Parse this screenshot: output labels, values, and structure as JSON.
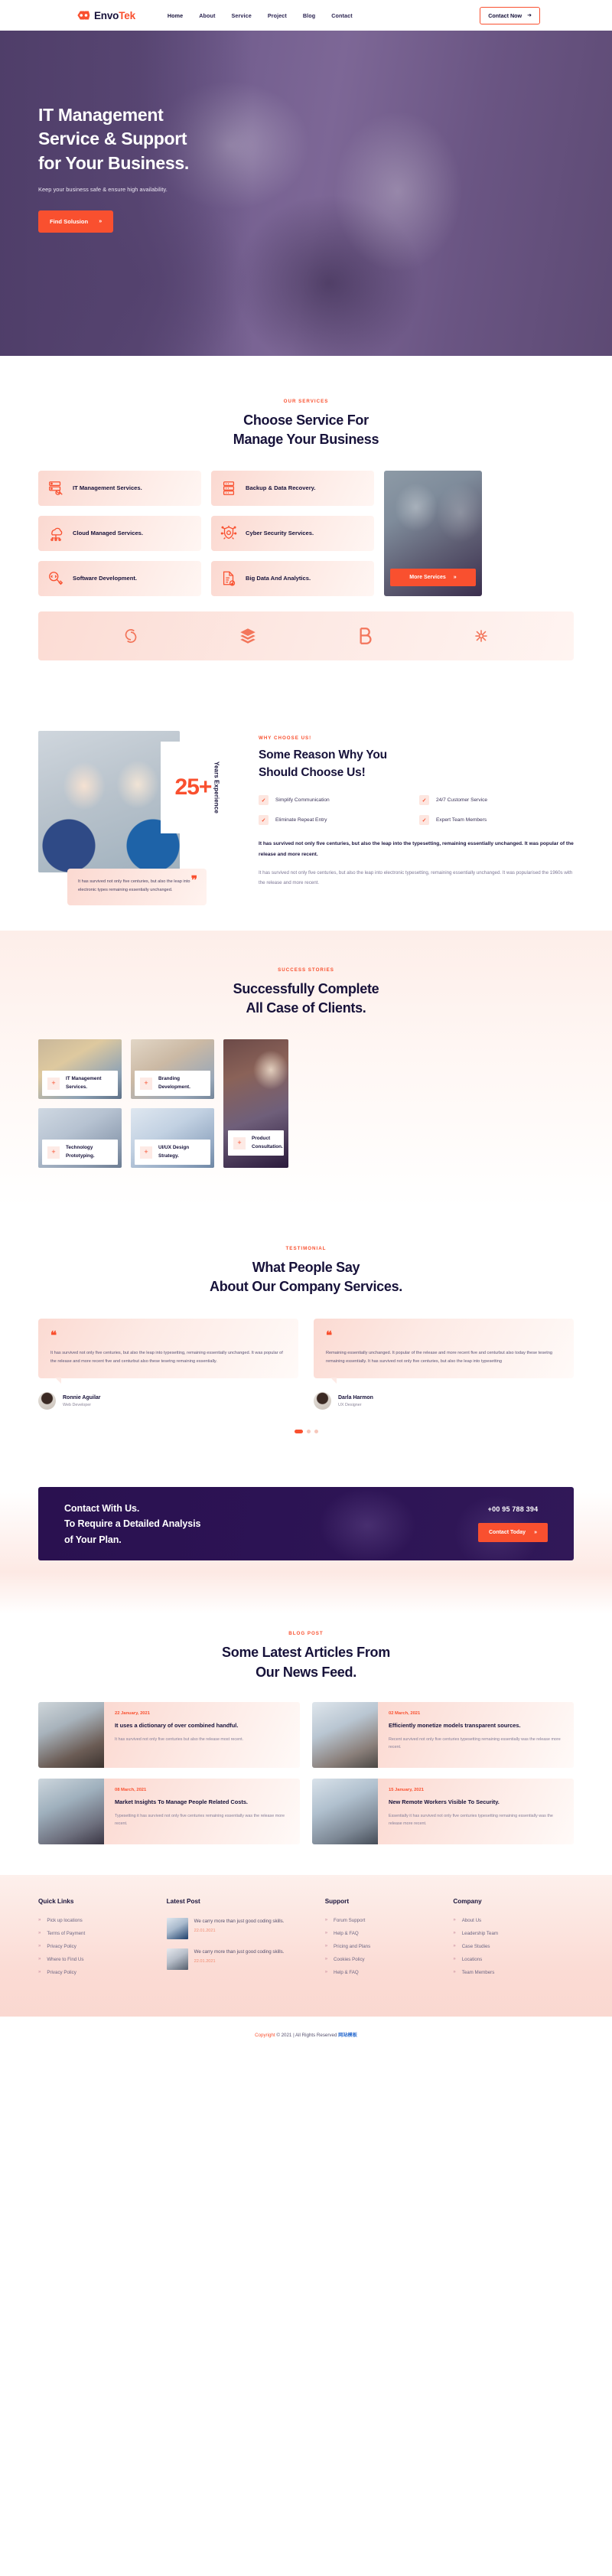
{
  "header": {
    "brand_primary": "Envo",
    "brand_accent": "Tek",
    "nav": [
      {
        "label": "Home",
        "active": true
      },
      {
        "label": "About",
        "active": false
      },
      {
        "label": "Service",
        "active": false
      },
      {
        "label": "Project",
        "active": false
      },
      {
        "label": "Blog",
        "active": false
      },
      {
        "label": "Contact",
        "active": false
      }
    ],
    "cta_label": "Contact Now",
    "cta_arrow": "➜"
  },
  "hero": {
    "title_line1": "IT Management",
    "title_line2": "Service & Support",
    "title_line3": "for Your Business.",
    "subtitle": "Keep your business safe & ensure high availability.",
    "button_label": "Find Solusion",
    "button_arrow": "»"
  },
  "services": {
    "eyebrow": "OUR SERVICES",
    "title_line1": "Choose Service For",
    "title_line2": "Manage Your Business",
    "left_items": [
      {
        "label": "IT Management Services.",
        "icon": "server-click-icon"
      },
      {
        "label": "Cloud Managed Services.",
        "icon": "cloud-network-icon"
      },
      {
        "label": "Software Development.",
        "icon": "code-badge-icon"
      }
    ],
    "right_items": [
      {
        "label": "Backup & Data Recovery.",
        "icon": "server-rack-icon"
      },
      {
        "label": "Cyber Security Services.",
        "icon": "shield-chip-icon"
      },
      {
        "label": "Big Data And Analytics.",
        "icon": "document-check-icon"
      }
    ],
    "more_button": "More Services",
    "more_arrow": "»"
  },
  "partners": [
    {
      "name": "spiral-logo"
    },
    {
      "name": "layers-logo"
    },
    {
      "name": "b-letter-logo"
    },
    {
      "name": "molecule-logo"
    }
  ],
  "why": {
    "eyebrow": "WHY CHOOSE US!",
    "title_line1": "Some Reason Why You",
    "title_line2": "Should Choose Us!",
    "badge_number": "25+",
    "badge_label": "Years Experience",
    "quote": "It has survived not only five centuries, but also the leap into electronic types remaining essentially unchanged.",
    "features": [
      "Simplify Communication",
      "24/7 Customer Service",
      "Eliminate Repeat Entry",
      "Expert Team Members"
    ],
    "lead": "It has survived not only five centuries, but also the leap into the typesetting, remaining essentially unchanged. It was popular of the release and more recent.",
    "body": "It has survived not only five centuries, but also the leap into electronic typesetting, remaining essentially unchanged. It was popularised the 1960s with the release and more recent."
  },
  "success": {
    "eyebrow": "SUCCESS STORIES",
    "title_line1": "Successfully Complete",
    "title_line2": "All Case of Clients.",
    "cases_col1": [
      "IT Management Services.",
      "Technology Prototyping."
    ],
    "cases_col2": [
      "Branding Development.",
      "UI/UX Design Strategy."
    ],
    "case_tall": "Product Consultation."
  },
  "testimonials": {
    "eyebrow": "TESTIMONIAL",
    "title_line1": "What People Say",
    "title_line2": "About Our Company Services.",
    "quote_mark": "❝",
    "items": [
      {
        "text": "It has survived not only five centuries, but also the leap into typesetting, remaining essentially unchanged. It was popular of the release and more recent five and centurbut also these tesetng remaining essentially.",
        "name": "Ronnie Aguilar",
        "role": "Web Developer"
      },
      {
        "text": "Remaining essentially unchanged. It popular of the release and more recent five and centurbut also today these tesetng remaining essentially. It has survived not only five centuries, but also the leap into typesetting",
        "name": "Darla Harmon",
        "role": "UX Designer"
      }
    ],
    "dots": 3,
    "active_dot": 0
  },
  "contact_band": {
    "line1": "Contact With Us.",
    "line2": "To Require a Detailed Analysis",
    "line3": "of Your Plan.",
    "phone": "+00 95 788 394",
    "button_label": "Contact Today",
    "button_arrow": "»"
  },
  "blog": {
    "eyebrow": "BLOG POST",
    "title_line1": "Some Latest Articles From",
    "title_line2": "Our News Feed.",
    "posts": [
      {
        "date": "22 January, 2021",
        "title": "It uses a dictionary of over combined handful.",
        "excerpt": "It has survived not only five centuries but also the release most recent."
      },
      {
        "date": "02 March, 2021",
        "title": "Efficiently monetize models transparent sources.",
        "excerpt": "Recent survived not only five centuries typesetting remaining essentially was the release more recent."
      },
      {
        "date": "08 March, 2021",
        "title": "Market Insights To Manage People Related Costs.",
        "excerpt": "Typesetting it has survived not only five centuries remaining essentially was the release more recent."
      },
      {
        "date": "15 January, 2021",
        "title": "New Remote Workers Visible To Security.",
        "excerpt": "Essentially it has survived not only five centuries typesetting remaining essentially was the release more recent."
      }
    ]
  },
  "footer": {
    "quick_links": {
      "heading": "Quick Links",
      "items": [
        "Pick up locations",
        "Terms of Payment",
        "Privacy Policy",
        "Where to Find Us",
        "Privacy Policy"
      ]
    },
    "latest_post": {
      "heading": "Latest Post",
      "items": [
        {
          "text": "We carry more than just good coding skills.",
          "date": "22.01.2021"
        },
        {
          "text": "We carry more than just good coding skills.",
          "date": "22.01.2021"
        }
      ]
    },
    "support": {
      "heading": "Support",
      "items": [
        "Forum Support",
        "Help & FAQ",
        "Pricing and Plans",
        "Cookies Policy",
        "Help & FAQ"
      ]
    },
    "company": {
      "heading": "Company",
      "items": [
        "About Us",
        "Leadership Team",
        "Case Studies",
        "Locations",
        "Team Members"
      ]
    },
    "copyright_prefix": "Copyright",
    "copyright_mid": "© 2021 | All Rights Reserved",
    "copyright_brand": "网站模板",
    "chevron": "»"
  },
  "colors": {
    "accent": "#f9502f",
    "dark": "#17123a",
    "hero_purple": "#6a5586",
    "band_purple": "#2a1150",
    "soft_pink": "#fbd9d1"
  }
}
